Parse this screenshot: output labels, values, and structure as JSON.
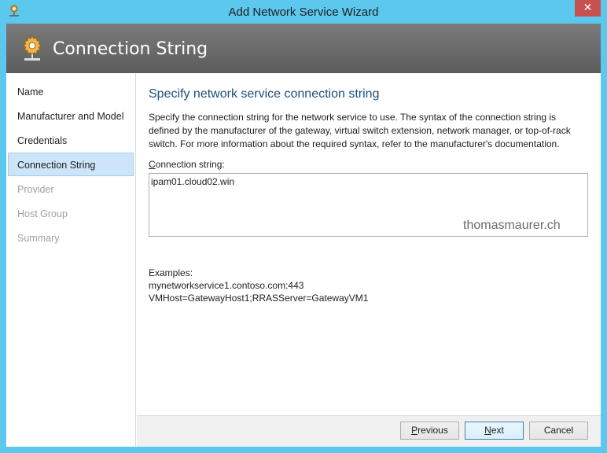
{
  "window": {
    "title": "Add Network Service Wizard",
    "close_glyph": "✕",
    "accent_color": "#5cc8ee"
  },
  "header": {
    "title": "Connection String",
    "icon": "network-service-icon"
  },
  "nav": {
    "items": [
      {
        "label": "Name",
        "state": "completed"
      },
      {
        "label": "Manufacturer and Model",
        "state": "completed"
      },
      {
        "label": "Credentials",
        "state": "completed"
      },
      {
        "label": "Connection String",
        "state": "selected"
      },
      {
        "label": "Provider",
        "state": "disabled"
      },
      {
        "label": "Host Group",
        "state": "disabled"
      },
      {
        "label": "Summary",
        "state": "disabled"
      }
    ]
  },
  "main": {
    "title": "Specify network service connection string",
    "description": "Specify the connection string for the network service to use. The syntax of the connection string is defined by the manufacturer of the gateway, virtual switch extension, network manager, or top-of-rack switch. For more information about the required syntax, refer to the manufacturer's documentation.",
    "field_label_access_key": "C",
    "field_label_rest": "onnection string:",
    "connection_string_value": "ipam01.cloud02.win",
    "watermark": "thomasmaurer.ch",
    "examples_heading": "Examples:",
    "examples": [
      "mynetworkservice1.contoso.com:443",
      "VMHost=GatewayHost1;RRASServer=GatewayVM1"
    ]
  },
  "footer": {
    "previous_key": "P",
    "previous_rest": "revious",
    "next_key": "N",
    "next_rest": "ext",
    "cancel_label": "Cancel"
  }
}
